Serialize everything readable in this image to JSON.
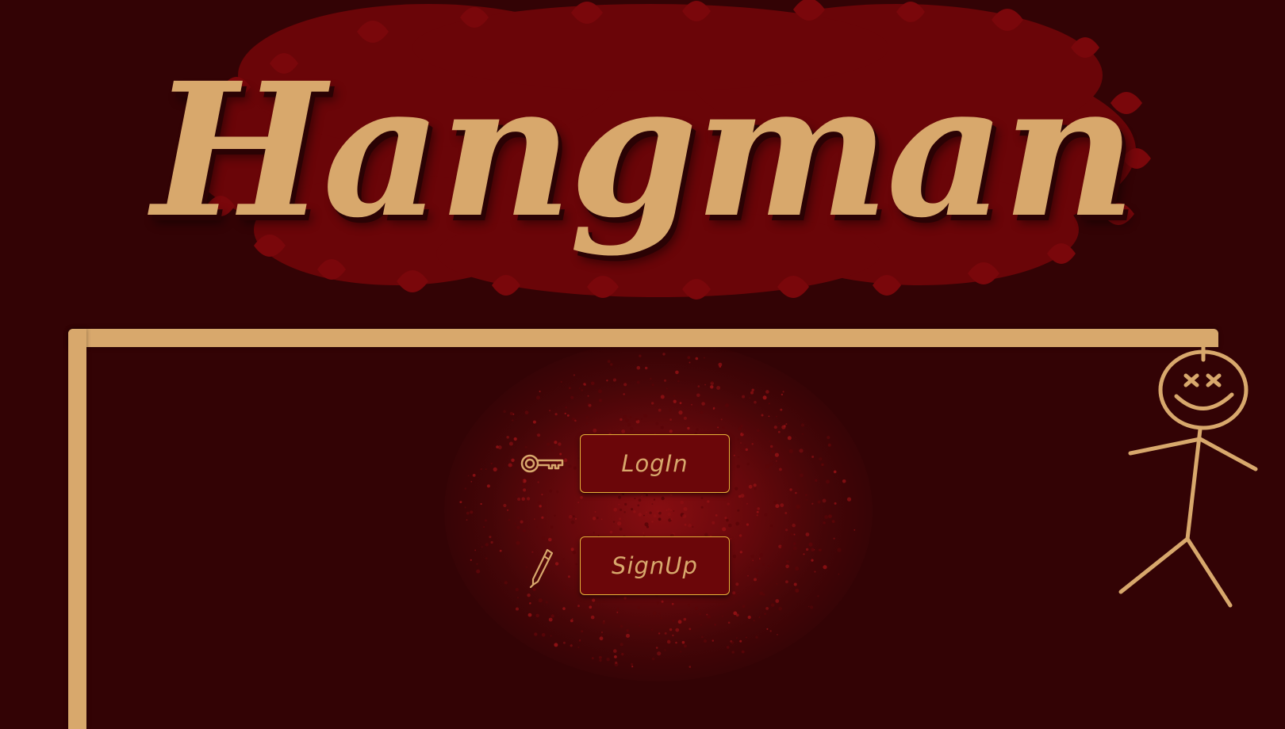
{
  "app": {
    "title": "Hangman"
  },
  "actions": {
    "login_label": "LogIn",
    "signup_label": "SignUp"
  },
  "icons": {
    "login": "key-icon",
    "signup": "pen-icon",
    "figure": "stickman-icon"
  },
  "colors": {
    "background": "#330305",
    "accent": "#d8a86c",
    "button_fill": "#6b0609",
    "button_border": "#e8b23a",
    "splash": "#6a0508"
  }
}
